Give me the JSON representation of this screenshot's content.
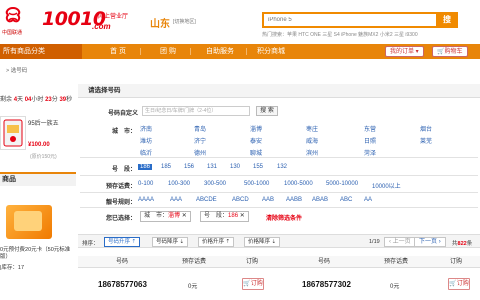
{
  "header": {
    "logo_sub": "中国联通",
    "brand": "10010",
    "brand_com": ".com",
    "brand_sub": "网上营业厅",
    "region": "山东",
    "region_switch": "[切换地区]",
    "search_placeholder": "iPhone 5",
    "search_button": "搜",
    "hot_label": "热门搜索：",
    "hot_items": "苹果  HTC ONE  三星  S4  iPhone  魅族MX2  小米2  三星  i9300"
  },
  "nav": {
    "category_label": "所有商品分类",
    "items": [
      "首 页",
      "团 购",
      "自助服务",
      "积分商城"
    ],
    "my_orders": "我的订单",
    "cart": "购物车"
  },
  "breadcrumb": "> 选号码",
  "sidebar": {
    "countdown_prefix": "剩余",
    "countdown_d": "4",
    "countdown_d_unit": "天",
    "countdown_h": "04",
    "countdown_h_unit": "小时",
    "countdown_m": "23",
    "countdown_m_unit": "分",
    "countdown_s": "39",
    "countdown_s_unit": "秒",
    "card_name": "95后一族五",
    "card_price": "¥100.00",
    "card_old": "(原价150元)",
    "section_title": "商品",
    "promo_text": "0元预付费20元卡（50元标准版）",
    "promo_stock": "|库存：17"
  },
  "panel": {
    "title": "请选择号码",
    "custom_label": "号码自定义",
    "custom_placeholder": "生日/纪念日/车牌/门牌（2-4位）",
    "custom_search": "搜 索",
    "city_label": "城　市：",
    "cities": [
      "济南",
      "青岛",
      "淄博",
      "枣庄",
      "东营",
      "烟台",
      "潍坊",
      "济宁",
      "泰安",
      "威海",
      "日照",
      "莱芜",
      "临沂",
      "德州",
      "聊城",
      "滨州",
      "菏泽"
    ],
    "segment_label": "号　段：",
    "segments": [
      "186",
      "185",
      "156",
      "131",
      "130",
      "155",
      "132"
    ],
    "fee_label": "预存话费：",
    "fees": [
      "0-100",
      "100-300",
      "300-500",
      "500-1000",
      "1000-5000",
      "5000-10000",
      "10000以上"
    ],
    "rule_label": "靓号规则：",
    "rules": [
      "AAAA",
      "AAA",
      "ABCDE",
      "ABCD",
      "AAB",
      "AABB",
      "ABAB",
      "ABC",
      "AA"
    ],
    "selected_label": "您已选择：",
    "sel_city_prefix": "城　市：",
    "sel_city": "淄博",
    "sel_seg_prefix": "号　段：",
    "sel_seg": "186",
    "clear": "清除筛选条件"
  },
  "sortbar": {
    "sort_label": "排序：",
    "buttons": [
      "号码升序",
      "号码降序",
      "价格升序",
      "价格降序"
    ],
    "page_info": "1/19",
    "prev": "上一页",
    "next": "下一页",
    "total_prefix": "共",
    "total_count": "822",
    "total_suffix": "条"
  },
  "table": {
    "headers": [
      "号码",
      "预存话费",
      "订购",
      "号码",
      "预存话费",
      "订购"
    ],
    "rows": [
      {
        "num1": "18678577063",
        "fee1": "0元",
        "order1": "订购",
        "num2": "18678577302",
        "fee2": "0元",
        "order2": "订购"
      }
    ]
  },
  "colors": {
    "brand_red": "#e60012",
    "nav_orange": "#e8850a",
    "link_blue": "#2a5fb0"
  }
}
